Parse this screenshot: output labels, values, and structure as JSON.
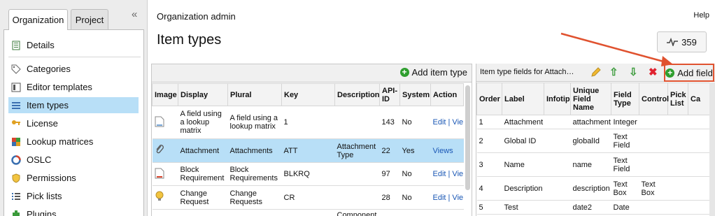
{
  "sidebar": {
    "tabs": [
      "Organization",
      "Project"
    ],
    "items": [
      {
        "label": "Details",
        "icon": "details-icon"
      },
      {
        "label": "Categories",
        "icon": "tag-icon"
      },
      {
        "label": "Editor templates",
        "icon": "template-icon"
      },
      {
        "label": "Item types",
        "icon": "list-icon"
      },
      {
        "label": "License",
        "icon": "key-icon"
      },
      {
        "label": "Lookup matrices",
        "icon": "matrix-icon"
      },
      {
        "label": "OSLC",
        "icon": "oslc-icon"
      },
      {
        "label": "Permissions",
        "icon": "shield-icon"
      },
      {
        "label": "Pick lists",
        "icon": "picklist-icon"
      },
      {
        "label": "Plugins",
        "icon": "plugin-icon"
      }
    ],
    "collapse_glyph": "«"
  },
  "header": {
    "breadcrumb": "Organization admin",
    "help": "Help",
    "title": "Item types",
    "counter": "359"
  },
  "item_types": {
    "add_label": "Add item type",
    "columns": [
      "Image",
      "Display",
      "Plural",
      "Key",
      "Description",
      "API-ID",
      "System",
      "Action"
    ],
    "rows": [
      {
        "display": "A field using a lookup matrix",
        "plural": "A field using a lookup matrix",
        "key": "1",
        "description": "",
        "api_id": "143",
        "system": "No",
        "action": "Edit | Vie"
      },
      {
        "display": "Attachment",
        "plural": "Attachments",
        "key": "ATT",
        "description": "Attachment Type",
        "api_id": "22",
        "system": "Yes",
        "action": "Views"
      },
      {
        "display": "Block Requirement",
        "plural": "Block Requirements",
        "key": "BLKRQ",
        "description": "",
        "api_id": "97",
        "system": "No",
        "action": "Edit | Vie"
      },
      {
        "display": "Change Request",
        "plural": "Change Requests",
        "key": "CR",
        "description": "",
        "api_id": "28",
        "system": "No",
        "action": "Edit | Vie"
      },
      {
        "display": "",
        "plural": "",
        "key": "",
        "description": "Component",
        "api_id": "",
        "system": "",
        "action": ""
      }
    ]
  },
  "fields": {
    "title": "Item type fields for Attach…",
    "add_label": "Add field",
    "columns": [
      "Order",
      "Label",
      "Infotip",
      "Unique Field Name",
      "Field Type",
      "Control",
      "Pick List",
      "Ca"
    ],
    "rows": [
      {
        "order": "1",
        "label": "Attachment",
        "infotip": "",
        "unique": "attachment",
        "type": "Integer",
        "control": "",
        "pick": ""
      },
      {
        "order": "2",
        "label": "Global ID",
        "infotip": "",
        "unique": "globalId",
        "type": "Text Field",
        "control": "",
        "pick": ""
      },
      {
        "order": "3",
        "label": "Name",
        "infotip": "",
        "unique": "name",
        "type": "Text Field",
        "control": "",
        "pick": ""
      },
      {
        "order": "4",
        "label": "Description",
        "infotip": "",
        "unique": "description",
        "type": "Text Box",
        "control": "Text Box",
        "pick": ""
      },
      {
        "order": "5",
        "label": "Test",
        "infotip": "",
        "unique": "date2",
        "type": "Date",
        "control": "",
        "pick": ""
      }
    ]
  },
  "colors": {
    "selection": "#b8dff7",
    "annotation": "#e0522f",
    "link": "#1a57b5",
    "add": "#2e9e2e"
  }
}
